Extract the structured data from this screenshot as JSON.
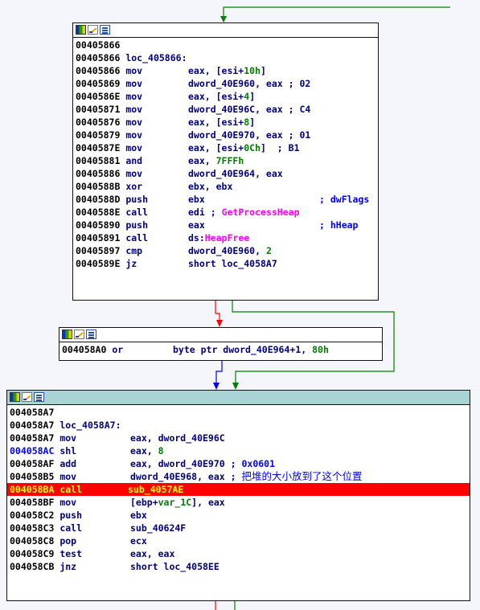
{
  "blocks": [
    {
      "title_color": "#ffffff",
      "lines": [
        {
          "addr": "00405866",
          "mn": "",
          "op": []
        },
        {
          "addr": "00405866",
          "mn": "loc_405866:",
          "op": []
        },
        {
          "addr": "00405866",
          "mn": "mov",
          "op": [
            {
              "t": "eax, [esi+",
              "c": "o"
            },
            {
              "t": "10h",
              "c": "n"
            },
            {
              "t": "]",
              "c": "o"
            }
          ]
        },
        {
          "addr": "00405869",
          "mn": "mov",
          "op": [
            {
              "t": "dword_40E960, eax ; 02",
              "c": "o"
            }
          ]
        },
        {
          "addr": "0040586E",
          "mn": "mov",
          "op": [
            {
              "t": "eax, [esi+",
              "c": "o"
            },
            {
              "t": "4",
              "c": "n"
            },
            {
              "t": "]",
              "c": "o"
            }
          ]
        },
        {
          "addr": "00405871",
          "mn": "mov",
          "op": [
            {
              "t": "dword_40E96C, eax ; C4",
              "c": "o"
            }
          ]
        },
        {
          "addr": "00405876",
          "mn": "mov",
          "op": [
            {
              "t": "eax, [esi+",
              "c": "o"
            },
            {
              "t": "8",
              "c": "n"
            },
            {
              "t": "]",
              "c": "o"
            }
          ]
        },
        {
          "addr": "00405879",
          "mn": "mov",
          "op": [
            {
              "t": "dword_40E970, eax ; 01",
              "c": "o"
            }
          ]
        },
        {
          "addr": "0040587E",
          "mn": "mov",
          "op": [
            {
              "t": "eax, [esi+",
              "c": "o"
            },
            {
              "t": "0Ch",
              "c": "n"
            },
            {
              "t": "]  ; B1",
              "c": "o"
            }
          ]
        },
        {
          "addr": "00405881",
          "mn": "and",
          "op": [
            {
              "t": "eax, ",
              "c": "o"
            },
            {
              "t": "7FFFh",
              "c": "n"
            }
          ]
        },
        {
          "addr": "00405886",
          "mn": "mov",
          "op": [
            {
              "t": "dword_40E964, eax",
              "c": "o"
            }
          ]
        },
        {
          "addr": "0040588B",
          "mn": "xor",
          "op": [
            {
              "t": "ebx, ebx",
              "c": "o"
            }
          ]
        },
        {
          "addr": "0040588D",
          "mn": "push",
          "op": [
            {
              "t": "ebx",
              "c": "o"
            }
          ],
          "cm": "; dwFlags"
        },
        {
          "addr": "0040588E",
          "mn": "call",
          "op": [
            {
              "t": "edi ",
              "c": "o"
            },
            {
              "t": "; ",
              "c": "c"
            },
            {
              "t": "GetProcessHeap",
              "c": "i"
            }
          ]
        },
        {
          "addr": "00405890",
          "mn": "push",
          "op": [
            {
              "t": "eax",
              "c": "o"
            }
          ],
          "cm": "; hHeap"
        },
        {
          "addr": "00405891",
          "mn": "call",
          "op": [
            {
              "t": "ds:",
              "c": "o"
            },
            {
              "t": "HeapFree",
              "c": "i"
            }
          ]
        },
        {
          "addr": "00405897",
          "mn": "cmp",
          "op": [
            {
              "t": "dword_40E960, ",
              "c": "o"
            },
            {
              "t": "2",
              "c": "n"
            }
          ]
        },
        {
          "addr": "0040589E",
          "mn": "jz",
          "op": [
            {
              "t": "short loc_4058A7",
              "c": "o"
            }
          ]
        }
      ]
    },
    {
      "title_color": "#ffffff",
      "lines": [
        {
          "addr": "004058A0",
          "mn": "or",
          "op": [
            {
              "t": "byte ptr dword_40E964+1, ",
              "c": "o"
            },
            {
              "t": "80h",
              "c": "n"
            }
          ]
        }
      ]
    },
    {
      "title_color": "#a8d4d6",
      "lines": [
        {
          "addr": "004058A7",
          "mn": "",
          "op": []
        },
        {
          "addr": "004058A7",
          "mn": "loc_4058A7:",
          "op": []
        },
        {
          "addr": "004058A7",
          "mn": "mov",
          "op": [
            {
              "t": "eax, dword_40E96C",
              "c": "o"
            }
          ]
        },
        {
          "addr": "004058AC",
          "mn": "shl",
          "op": [
            {
              "t": "eax, ",
              "c": "o"
            },
            {
              "t": "8",
              "c": "n"
            }
          ],
          "addr_blue": true
        },
        {
          "addr": "004058AF",
          "mn": "add",
          "op": [
            {
              "t": "eax, dword_40E970 ",
              "c": "o"
            },
            {
              "t": "; 0x0601",
              "c": "c"
            }
          ]
        },
        {
          "addr": "004058B5",
          "mn": "mov",
          "op": [
            {
              "t": "dword_40E968, eax ",
              "c": "o"
            },
            {
              "t": "; ",
              "c": "c"
            },
            {
              "t": "把堆的大小放到了这个位置",
              "c": "z"
            }
          ]
        },
        {
          "addr": "004058BA",
          "mn": "call",
          "op": [
            {
              "t": "sub_4057AE",
              "c": "o"
            }
          ],
          "hl": true
        },
        {
          "addr": "004058BF",
          "mn": "mov",
          "op": [
            {
              "t": "[ebp+",
              "c": "o"
            },
            {
              "t": "var_1C",
              "c": "n"
            },
            {
              "t": "], eax",
              "c": "o"
            }
          ]
        },
        {
          "addr": "004058C2",
          "mn": "push",
          "op": [
            {
              "t": "ebx",
              "c": "o"
            }
          ]
        },
        {
          "addr": "004058C3",
          "mn": "call",
          "op": [
            {
              "t": "sub_40624F",
              "c": "o"
            }
          ]
        },
        {
          "addr": "004058C8",
          "mn": "pop",
          "op": [
            {
              "t": "ecx",
              "c": "o"
            }
          ]
        },
        {
          "addr": "004058C9",
          "mn": "test",
          "op": [
            {
              "t": "eax, eax",
              "c": "o"
            }
          ]
        },
        {
          "addr": "004058CB",
          "mn": "jnz",
          "op": [
            {
              "t": "short loc_4058EE",
              "c": "o"
            }
          ]
        }
      ]
    }
  ],
  "colors": {
    "edge_false": "#ff0000",
    "edge_true": "#008000",
    "edge_uncond": "#0000ff",
    "highlight": "#ff0000"
  }
}
